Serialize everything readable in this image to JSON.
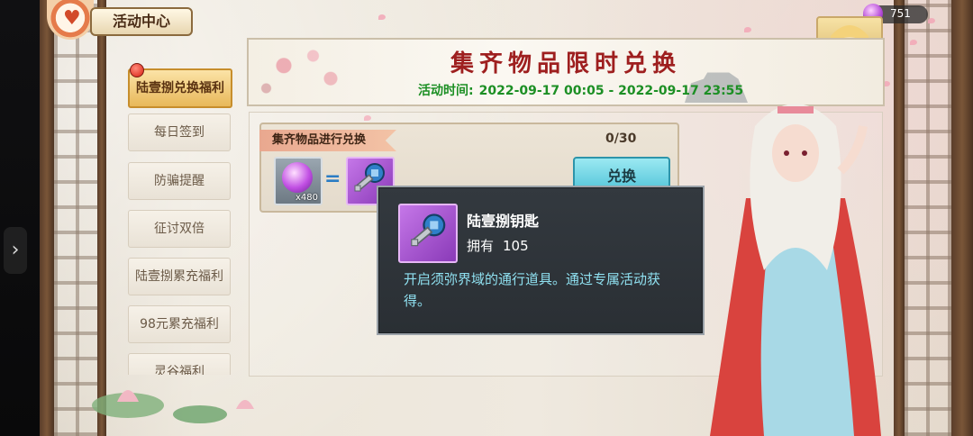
{
  "header": {
    "activity_center": "活动中心",
    "currency_value": "751"
  },
  "sidebar": {
    "items": [
      {
        "label": "陆壹捌兑换福利",
        "active": true
      },
      {
        "label": "每日签到"
      },
      {
        "label": "防骗提醒"
      },
      {
        "label": "征讨双倍"
      },
      {
        "label": "陆壹捌累充福利"
      },
      {
        "label": "98元累充福利"
      },
      {
        "label": "灵谷福利"
      }
    ]
  },
  "banner": {
    "title": "集齐物品限时兑换",
    "time_label": "活动时间:",
    "time_range": "2022-09-17  00:05 - 2022-09-17  23:55"
  },
  "exchange": {
    "ribbon": "集齐物品进行兑换",
    "progress": "0/30",
    "input_qty": "x480",
    "button": "兑换"
  },
  "tooltip": {
    "name": "陆壹捌钥匙",
    "own_label": "拥有",
    "own_count": "105",
    "description": "开启须弥界域的通行道具。通过专属活动获得。"
  },
  "colors": {
    "accent_gold": "#e8b85a",
    "title_red": "#9e1f1f",
    "time_green": "#1c8f24",
    "tooltip_desc": "#8fe0f0",
    "exchange_button": "#4bc0d6"
  },
  "icons": {
    "currency": "purple-gem-icon",
    "exchange_in": "purple-gem-icon",
    "exchange_out": "key-icon",
    "social": "wechat-icon"
  }
}
